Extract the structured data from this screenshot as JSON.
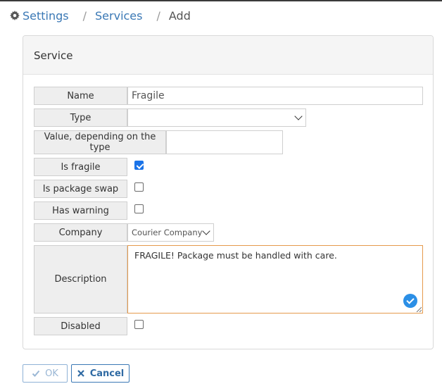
{
  "breadcrumb": {
    "icon": "gear-icon",
    "items": [
      "Settings",
      "Services",
      "Add"
    ],
    "separator": "/"
  },
  "panel": {
    "title": "Service"
  },
  "form": {
    "name": {
      "label": "Name",
      "value": "Fragile"
    },
    "type": {
      "label": "Type",
      "value": ""
    },
    "value_dep": {
      "label": "Value, depending on the type",
      "value": ""
    },
    "is_fragile": {
      "label": "Is fragile",
      "checked": true
    },
    "is_package_swap": {
      "label": "Is package swap",
      "checked": false
    },
    "has_warning": {
      "label": "Has warning",
      "checked": false
    },
    "company": {
      "label": "Company",
      "value": "Courier Company"
    },
    "description": {
      "label": "Description",
      "value": "FRAGILE! Package must be handled with care."
    },
    "disabled": {
      "label": "Disabled",
      "checked": false
    }
  },
  "buttons": {
    "ok": "OK",
    "cancel": "Cancel"
  },
  "colors": {
    "link": "#3a78b5",
    "accent": "#1a73e8",
    "focus_border": "#e59a4c"
  }
}
